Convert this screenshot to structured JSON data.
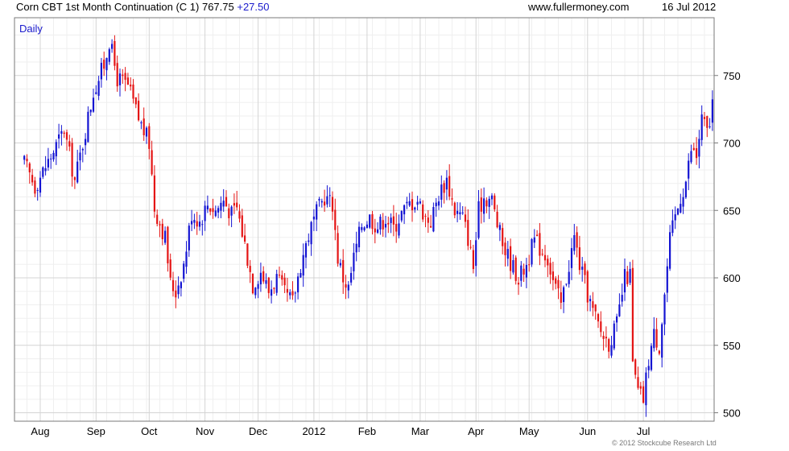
{
  "header": {
    "title": "Corn CBT 1st Month Continuation (C 1) 767.75",
    "change": "+27.50",
    "site": "www.fullermoney.com",
    "date": "16 Jul 2012"
  },
  "footer": {
    "copyright": "© 2012 Stockcube Research Ltd"
  },
  "colors": {
    "up": "#1414d2",
    "down": "#e41414",
    "grid": "#d4d4d4",
    "minor_grid": "#efefef",
    "frame": "#7a7a7a"
  },
  "chart_data": {
    "type": "candlestick",
    "period_label": "Daily",
    "ylim": [
      495,
      780
    ],
    "y_ticks": [
      500,
      550,
      600,
      650,
      700,
      750
    ],
    "grid": true,
    "x_labels": [
      {
        "label": "Aug",
        "day": 0
      },
      {
        "label": "Sep",
        "day": 21
      },
      {
        "label": "Oct",
        "day": 41
      },
      {
        "label": "Nov",
        "day": 62
      },
      {
        "label": "Dec",
        "day": 82
      },
      {
        "label": "2012",
        "day": 103
      },
      {
        "label": "Feb",
        "day": 123
      },
      {
        "label": "Mar",
        "day": 143
      },
      {
        "label": "Apr",
        "day": 164
      },
      {
        "label": "May",
        "day": 184
      },
      {
        "label": "Jun",
        "day": 206
      },
      {
        "label": "Jul",
        "day": 227
      }
    ],
    "price_path": [
      [
        -6,
        685
      ],
      [
        -2,
        668
      ],
      [
        4,
        690
      ],
      [
        9,
        710
      ],
      [
        13,
        672
      ],
      [
        16,
        700
      ],
      [
        20,
        738
      ],
      [
        24,
        758
      ],
      [
        26,
        776
      ],
      [
        29,
        748
      ],
      [
        33,
        742
      ],
      [
        37,
        718
      ],
      [
        41,
        700
      ],
      [
        43,
        652
      ],
      [
        47,
        630
      ],
      [
        49,
        596
      ],
      [
        51,
        590
      ],
      [
        54,
        610
      ],
      [
        57,
        648
      ],
      [
        60,
        642
      ],
      [
        63,
        655
      ],
      [
        66,
        650
      ],
      [
        69,
        658
      ],
      [
        72,
        647
      ],
      [
        74,
        652
      ],
      [
        77,
        625
      ],
      [
        80,
        595
      ],
      [
        83,
        605
      ],
      [
        86,
        590
      ],
      [
        89,
        600
      ],
      [
        92,
        588
      ],
      [
        95,
        582
      ],
      [
        98,
        610
      ],
      [
        101,
        632
      ],
      [
        104,
        648
      ],
      [
        107,
        660
      ],
      [
        110,
        655
      ],
      [
        112,
        615
      ],
      [
        114,
        600
      ],
      [
        116,
        592
      ],
      [
        118,
        615
      ],
      [
        121,
        640
      ],
      [
        124,
        645
      ],
      [
        127,
        638
      ],
      [
        130,
        645
      ],
      [
        133,
        637
      ],
      [
        136,
        648
      ],
      [
        139,
        655
      ],
      [
        142,
        658
      ],
      [
        145,
        645
      ],
      [
        147,
        642
      ],
      [
        150,
        662
      ],
      [
        153,
        673
      ],
      [
        156,
        650
      ],
      [
        159,
        645
      ],
      [
        161,
        630
      ],
      [
        163,
        608
      ],
      [
        165,
        650
      ],
      [
        167,
        660
      ],
      [
        170,
        658
      ],
      [
        172,
        640
      ],
      [
        174,
        625
      ],
      [
        177,
        612
      ],
      [
        180,
        600
      ],
      [
        183,
        610
      ],
      [
        186,
        628
      ],
      [
        189,
        620
      ],
      [
        191,
        615
      ],
      [
        193,
        598
      ],
      [
        196,
        580
      ],
      [
        198,
        600
      ],
      [
        201,
        630
      ],
      [
        203,
        610
      ],
      [
        206,
        588
      ],
      [
        208,
        575
      ],
      [
        211,
        560
      ],
      [
        214,
        552
      ],
      [
        217,
        565
      ],
      [
        220,
        600
      ],
      [
        222,
        602
      ],
      [
        223,
        535
      ],
      [
        225,
        515
      ],
      [
        227,
        510
      ],
      [
        229,
        540
      ],
      [
        231,
        558
      ],
      [
        233,
        550
      ],
      [
        235,
        588
      ],
      [
        237,
        628
      ],
      [
        239,
        645
      ],
      [
        241,
        660
      ],
      [
        243,
        672
      ],
      [
        245,
        695
      ],
      [
        247,
        690
      ],
      [
        249,
        718
      ],
      [
        251,
        708
      ],
      [
        252,
        715
      ],
      [
        253,
        730
      ],
      [
        254,
        740
      ],
      [
        255,
        768
      ]
    ]
  }
}
